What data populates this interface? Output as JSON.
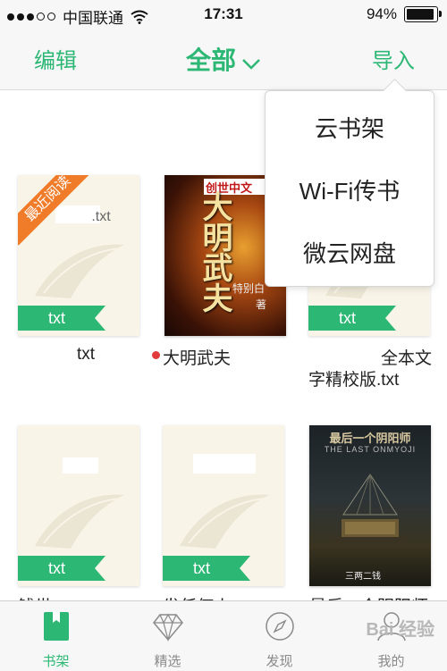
{
  "status_bar": {
    "carrier": "中国联通",
    "time": "17:31",
    "battery_text": "94%",
    "signal_bars_filled": 3,
    "signal_bars_total": 5,
    "battery_level": 0.94
  },
  "nav": {
    "edit_label": "编辑",
    "title": "全部",
    "import_label": "导入"
  },
  "import_menu": {
    "items": [
      {
        "label": "云书架"
      },
      {
        "label": "Wi-Fi传书"
      },
      {
        "label": "微云网盘"
      }
    ]
  },
  "books": [
    {
      "cover_text": ".txt",
      "badge": "最近阅读",
      "tag": "txt",
      "title": "txt"
    },
    {
      "title": "大明武夫",
      "cover_title": "大明武夫",
      "cover_logo": "创世中文",
      "cover_author": "特别白",
      "cover_author_suffix": "著",
      "unread": true
    },
    {
      "tag": "txt",
      "title_line1": "全本文",
      "title_line2": "字精校版.txt"
    },
    {
      "tag": "txt",
      "title": "钱世"
    },
    {
      "tag": "txt",
      "title": "发任何小"
    },
    {
      "title": "最后一个阴阳师",
      "cover_title": "最后一个阴阳师",
      "cover_subtitle": "THE LAST ONMYOJI",
      "cover_author": "三两二钱"
    }
  ],
  "tabbar": {
    "tabs": [
      {
        "label": "书架",
        "icon": "bookshelf-icon",
        "active": true
      },
      {
        "label": "精选",
        "icon": "diamond-icon",
        "active": false
      },
      {
        "label": "发现",
        "icon": "compass-icon",
        "active": false
      },
      {
        "label": "我的",
        "icon": "person-icon",
        "active": false
      }
    ]
  },
  "watermark": "Bai 经验",
  "colors": {
    "accent": "#2db774",
    "ribbon": "#f07c2a",
    "unread_dot": "#e03a3a"
  }
}
